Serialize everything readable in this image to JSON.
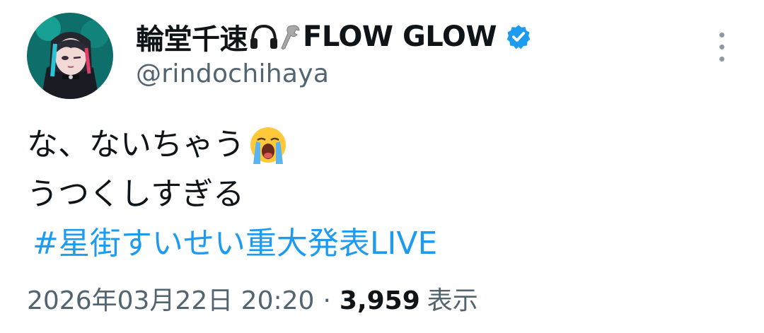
{
  "author": {
    "display_name": "輪堂千速",
    "name_suffix": "FLOW GLOW",
    "handle": "@rindochihaya",
    "verified": true,
    "name_icons": [
      "headphones-icon",
      "wrench-icon"
    ],
    "verified_color": "#1d9bf0"
  },
  "tweet": {
    "line1": "な、ないちゃう",
    "line1_emoji": "loudly-crying-face-emoji",
    "line2": "うつくしすぎる",
    "hashtag": "#星街すいせい重大発表LIVE"
  },
  "meta": {
    "timestamp": "2026年03月22日 20:20",
    "separator": "·",
    "views_count": "3,959",
    "views_label": "表示"
  },
  "colors": {
    "link": "#1d9bf0",
    "secondary_text": "#536471",
    "primary_text": "#0f1419"
  }
}
